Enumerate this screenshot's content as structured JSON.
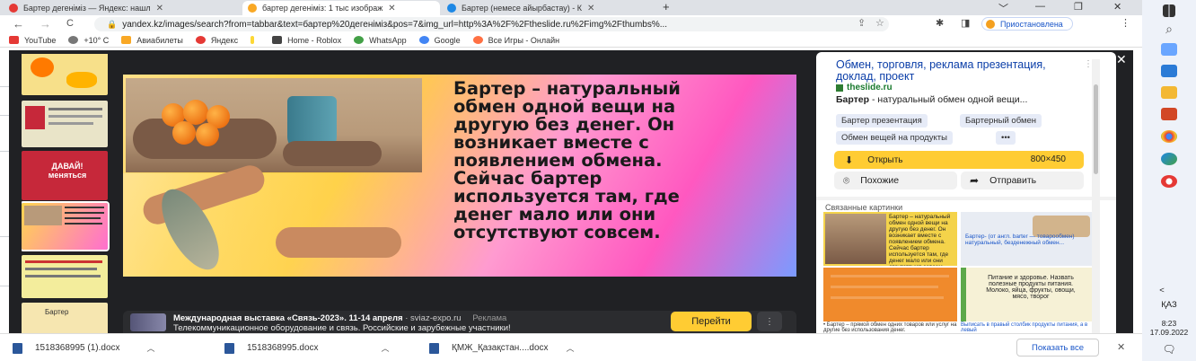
{
  "tabs": [
    {
      "label": "Бартер дегеніміз — Яндекс: нашл",
      "favicon_color": "#e53935"
    },
    {
      "label": "бартер дегеніміз: 1 тыс изображ",
      "favicon_color": "#f9a825"
    },
    {
      "label": "Бартер (немесе айырбастау) - К",
      "favicon_color": "#1e88e5"
    }
  ],
  "window_controls": {
    "minimize": "—",
    "maximize": "❐",
    "close": "✕",
    "chevron": "﹀",
    "new_tab": "+"
  },
  "nav": {
    "back": "←",
    "forward": "→",
    "reload": "C"
  },
  "address": {
    "url": "yandex.kz/images/search?from=tabbar&text=бартер%20дегеніміз&pos=7&img_url=http%3A%2F%2Ftheslide.ru%2Fimg%2Fthumbs%...",
    "lock": "🔒"
  },
  "profile_pill": "Приостановлена",
  "bookmarks": [
    {
      "label": "YouTube",
      "color": "#e53935"
    },
    {
      "label": "+10° C",
      "color": "#777"
    },
    {
      "label": "Авиабилеты",
      "color": "#f9a825"
    },
    {
      "label": "Яндекс",
      "color": "#e53935"
    },
    {
      "label": "",
      "color": "#fdd835"
    },
    {
      "label": "Home - Roblox",
      "color": "#444"
    },
    {
      "label": "WhatsApp",
      "color": "#43a047"
    },
    {
      "label": "Google",
      "color": "#4285f4"
    },
    {
      "label": "Все Игры - Онлайн",
      "color": "#ff7043"
    }
  ],
  "slide": {
    "lines": [
      "Бартер – натуральный",
      "обмен одной вещи на",
      "другую без денег. Он",
      "возникает вместе с",
      "появлением обмена.",
      "Сейчас бартер",
      "используется там, где",
      "денег мало или они",
      "отсутствуют совсем."
    ]
  },
  "thumbs": [
    {
      "color": "#f7e08a"
    },
    {
      "color": "#e9e4c8"
    },
    {
      "color": "#c6283a"
    },
    {
      "color": "#c9a46c"
    },
    {
      "color": "#f3ed9c"
    },
    {
      "color": "#f6e6b0"
    }
  ],
  "thumb_texts": [
    "ДАВАЙ! меняться",
    "Бартер"
  ],
  "ad": {
    "title": "Международная выставка «Связь-2023». 11-14 апреля",
    "domain": "sviaz-expo.ru",
    "badge": "Реклама",
    "subtitle": "Телекоммуникационное оборудование и связь. Российские и зарубежные участники!",
    "go_label": "Перейти",
    "more_label": "⋮"
  },
  "panel": {
    "title": "Обмен, торговля, реклама презентация, доклад, проект",
    "site": "theslide.ru",
    "desc_bold": "Бартер",
    "desc_rest": " - натуральный обмен одной вещи...",
    "chips": [
      "Бартер презентация",
      "Бартерный обмен",
      "Обмен вещей на продукты",
      "•••"
    ],
    "open_label": "Открыть",
    "open_size": "800×450",
    "similar_label": "Похожие",
    "share_label": "Отправить",
    "related_heading": "Связанные картинки",
    "related": [
      {
        "text": "Бартер – натуральный обмен одной вещи на другую без денег. Он возникает вместе с появлением обмена. Сейчас бартер используется там, где денег мало или они отсутствуют совсем.",
        "color": "#f4d34a"
      },
      {
        "text": "Бартер- (от англ. barter — товарообмен) натуральный, безденежный обмен...",
        "color": "#e8ecf3"
      },
      {
        "text": "",
        "color": "#f08a2c"
      },
      {
        "text": "Питание и здоровье. Назвать полезные продукты питания. Молоко, яйца, фрукты, овощи, мясо, творог",
        "color": "#f6f1d6"
      }
    ],
    "related_caption_left": "• Бартер – прямой обмен одних товаров или услуг на другие без использования денег.",
    "related_caption_right": "Выписать в правый столбик продукты питания, а в левый"
  },
  "downloads": [
    {
      "name": "1518368995 (1).docx"
    },
    {
      "name": "1518368995.docx"
    },
    {
      "name": "ҚМЖ_Қазақстан....docx"
    }
  ],
  "downloads_show_all": "Показать все",
  "taskbar": {
    "lang": "ҚАЗ",
    "time": "8:23",
    "date": "17.09.2022",
    "chevron": "<",
    "icons": [
      {
        "name": "search",
        "color": "#555"
      },
      {
        "name": "stickies",
        "color": "#6aa6ff"
      },
      {
        "name": "store",
        "color": "#2b7bd6"
      },
      {
        "name": "explorer",
        "color": "#f3b833"
      },
      {
        "name": "presentation",
        "color": "#d24726"
      },
      {
        "name": "chrome",
        "color": "#e53935"
      },
      {
        "name": "edge",
        "color": "#1e88e5"
      },
      {
        "name": "opera",
        "color": "#e53935"
      }
    ]
  }
}
